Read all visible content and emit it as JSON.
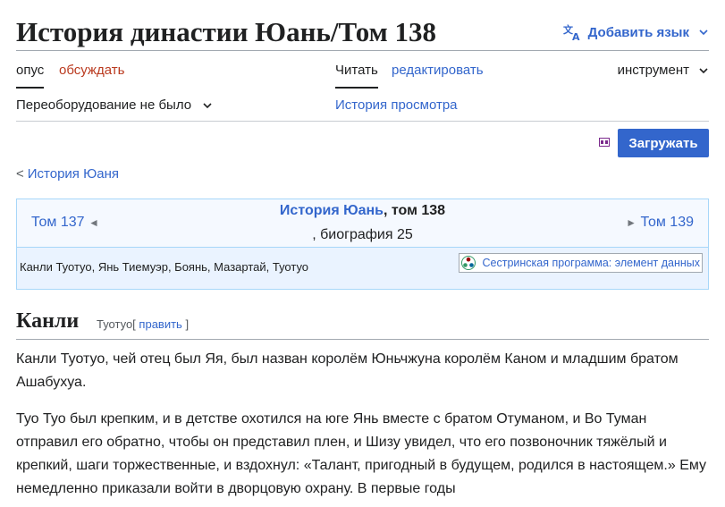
{
  "page": {
    "title": "История династии Юань/Том 138",
    "add_language": "Добавить язык"
  },
  "tabs": {
    "opus": "опус",
    "discuss": "обсуждать",
    "read": "Читать",
    "edit": "редактировать",
    "tools": "инструмент"
  },
  "subbar": {
    "conversion": "Переоборудование не было",
    "history": "История просмотра"
  },
  "toolbar": {
    "download": "Загружать"
  },
  "breadcrumb": {
    "arrow": "<",
    "label": "История Юаня"
  },
  "header": {
    "prev": "Том 137",
    "prev_arrow": "◄",
    "next": "Том 139",
    "next_arrow": "►",
    "title_link": "История Юань",
    "title_rest": ", том 138",
    "subtitle": ", биография 25",
    "persons": "Канли Туотуо, Янь Тиемуэр, Боянь, Мазартай, Туотуо",
    "sister_program": "Сестринская программа: элемент данных"
  },
  "section": {
    "title": "Канли",
    "sub_name": "Туотуо",
    "edit_open": "[",
    "edit_label": "править",
    "edit_close": "]"
  },
  "paragraphs": [
    "Канли Туотуо, чей отец был Яя, был назван королём Юньчжуна королём Каном и младшим братом Ашабухуа.",
    "Туо Туо был крепким, и в детстве охотился на юге Янь вместе с братом Отуманом, и Во Туман отправил его обратно, чтобы он представил плен, и Шизу увидел, что его позвоночник тяжёлый и крепкий, шаги торжественные, и вздохнул: «Талант, пригодный в будущем, родился в настоящем.» Ему немедленно приказали войти в дворцовую охрану. В первые годы"
  ],
  "colors": {
    "link": "#3366cc",
    "link_red": "#ba3a1f",
    "button": "#3366cc",
    "header_bg": "#eaf3ff",
    "header_border": "#a7d7f9"
  },
  "icons": [
    "translate-icon",
    "chevron-down-icon",
    "download-format-icon",
    "wikidata-icon"
  ]
}
